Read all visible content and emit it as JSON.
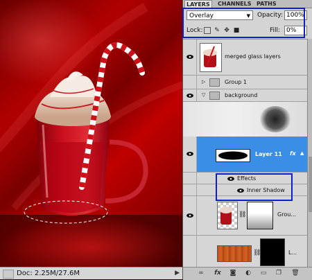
{
  "panel": {
    "tabs": [
      "LAYERS",
      "CHANNELS",
      "PATHS"
    ],
    "blend_mode": "Overlay",
    "opacity_label": "Opacity:",
    "opacity_value": "100%",
    "lock_label": "Lock:",
    "fill_label": "Fill:",
    "fill_value": "0%"
  },
  "layers": {
    "merged": "merged glass layers",
    "group1": "Group 1",
    "background": "background",
    "layer11": "Layer 11",
    "fx": "fx",
    "effects": "Effects",
    "inner_shadow": "Inner Shadow",
    "group_row": "Grou...",
    "last_row": "L..."
  },
  "status": {
    "doc": "Doc: 2.25M/27.6M"
  },
  "colors": {
    "selection": "#3a8ee6",
    "highlight_box": "#0b1fd1"
  }
}
